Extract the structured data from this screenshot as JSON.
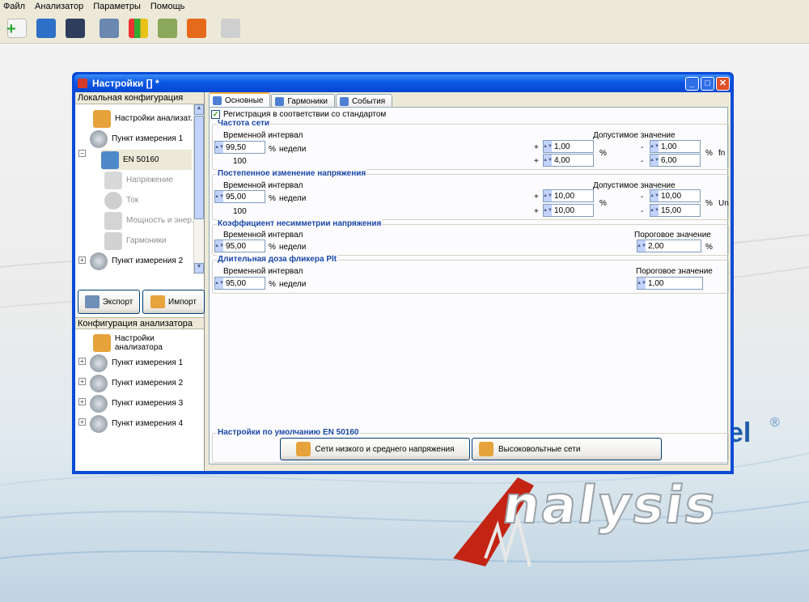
{
  "menu": [
    "Файл",
    "Анализатор",
    "Параметры",
    "Помощь"
  ],
  "toolbar": {
    "icons": [
      "new-file-icon",
      "open-folder-icon",
      "save-icon",
      "analyzer-icon",
      "chart-icon",
      "device-icon",
      "settings-icon",
      "connect-icon"
    ]
  },
  "brand": {
    "wordmark": "nalysis",
    "partial": "el",
    "reg": "®"
  },
  "window": {
    "title": "Настройки [] *",
    "buttons": {
      "minimize": "_",
      "maximize": "□",
      "close": "✕"
    }
  },
  "local_config": {
    "header": "Локальная конфигурация",
    "items": [
      {
        "label": "Настройки анализат...",
        "icon": "analyzer-settings-icon"
      },
      {
        "label": "Пункт измерения 1",
        "icon": "measurement-point-icon"
      },
      {
        "label": "EN 50160",
        "icon": "en50160-icon"
      },
      {
        "label": "Напряжение",
        "icon": "voltage-icon"
      },
      {
        "label": "Ток",
        "icon": "current-icon"
      },
      {
        "label": "Мощность и энер...",
        "icon": "power-icon"
      },
      {
        "label": "Гармоники",
        "icon": "harmonics-icon"
      },
      {
        "label": "Пункт измерения 2",
        "icon": "measurement-point-icon"
      }
    ],
    "export_label": "Экспорт",
    "import_label": "Импорт"
  },
  "analyzer_config": {
    "header": "Конфигурация анализатора",
    "items": [
      {
        "label": "Настройки анализатора"
      },
      {
        "label": "Пункт измерения 1"
      },
      {
        "label": "Пункт измерения 2"
      },
      {
        "label": "Пункт измерения 3"
      },
      {
        "label": "Пункт измерения 4"
      }
    ]
  },
  "tabs": [
    "Основные",
    "Гармоники",
    "События"
  ],
  "main": {
    "checkbox_label": "Регистрация в соответствии со стандартом",
    "frequency": {
      "title": "Частота сети",
      "interval_label": "Временной интервал",
      "allowed_label": "Допустимое значение",
      "interval_value": "99,50",
      "percent": "%",
      "weeks": "недели",
      "weeks_count": "100",
      "plus": "+",
      "minus": "-",
      "plus1": "1,00",
      "plus2": "4,00",
      "minus1": "1,00",
      "minus2": "6,00",
      "unit": "fn"
    },
    "voltage_change": {
      "title": "Постепенное изменение напряжения",
      "interval_label": "Временной интервал",
      "allowed_label": "Допустимое значение",
      "interval_value": "95,00",
      "percent": "%",
      "weeks": "недели",
      "weeks_count": "100",
      "plus": "+",
      "minus": "-",
      "plus1": "10,00",
      "plus2": "10,00",
      "minus1": "10,00",
      "minus2": "15,00",
      "unit": "Un"
    },
    "asymmetry": {
      "title": "Коэффициент несимметрии напряжения",
      "interval_label": "Временной интервал",
      "threshold_label": "Пороговое значение",
      "interval_value": "95,00",
      "percent": "%",
      "weeks": "недели",
      "threshold_value": "2,00"
    },
    "flicker": {
      "title": "Длительная доза фликера Plt",
      "interval_label": "Временной интервал",
      "threshold_label": "Пороговое значение",
      "interval_value": "95,00",
      "percent": "%",
      "weeks": "недели",
      "threshold_value": "1,00"
    },
    "defaults": {
      "title": "Настройки по умолчанию EN 50160",
      "low_medium_label": "Сети низкого и среднего напряжения",
      "high_label": "Высоковольтные сети"
    }
  }
}
